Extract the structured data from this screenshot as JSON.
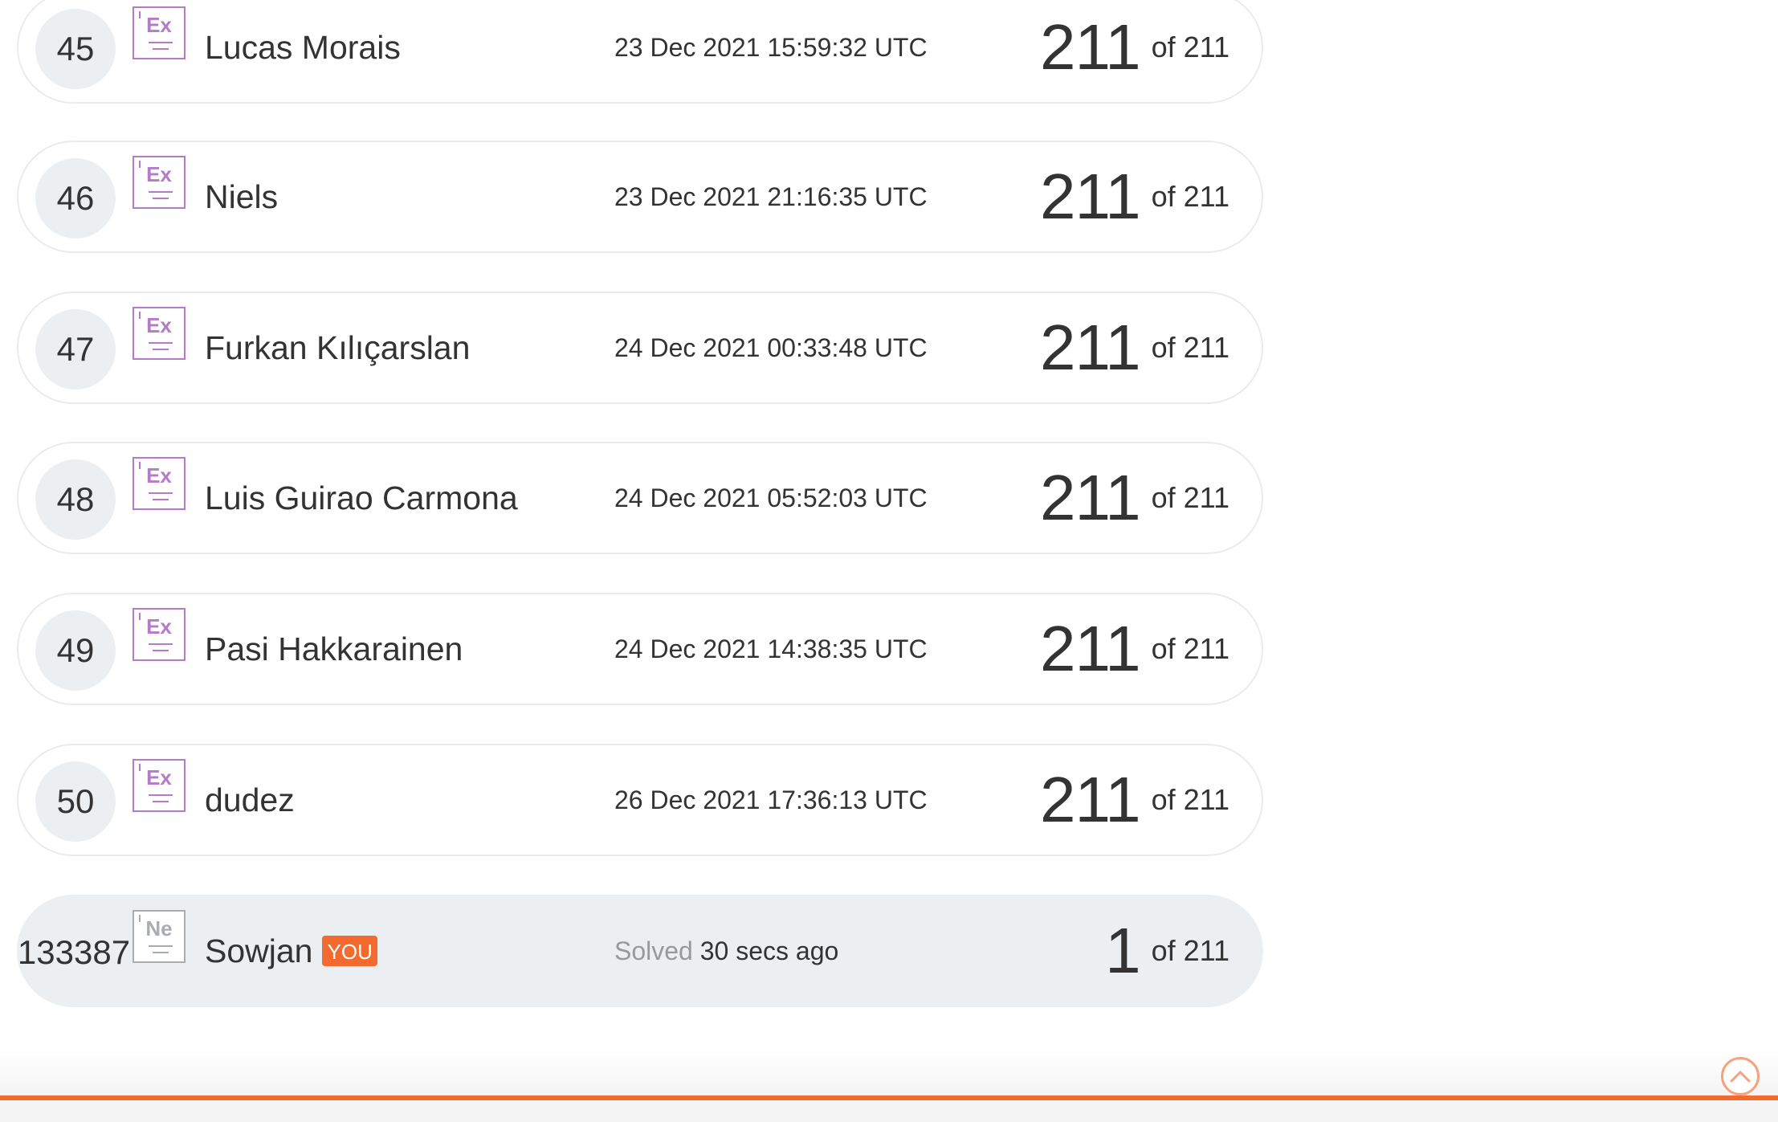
{
  "leaderboard": {
    "rows": [
      {
        "rank": "45",
        "badge": "Ex",
        "name": "Lucas Morais",
        "date": "23 Dec 2021 15:59:32 UTC",
        "score": "211",
        "of": "of 211"
      },
      {
        "rank": "46",
        "badge": "Ex",
        "name": "Niels",
        "date": "23 Dec 2021 21:16:35 UTC",
        "score": "211",
        "of": "of 211"
      },
      {
        "rank": "47",
        "badge": "Ex",
        "name": "Furkan Kılıçarslan",
        "date": "24 Dec 2021 00:33:48 UTC",
        "score": "211",
        "of": "of 211"
      },
      {
        "rank": "48",
        "badge": "Ex",
        "name": "Luis Guirao Carmona",
        "date": "24 Dec 2021 05:52:03 UTC",
        "score": "211",
        "of": "of 211"
      },
      {
        "rank": "49",
        "badge": "Ex",
        "name": "Pasi Hakkarainen",
        "date": "24 Dec 2021 14:38:35 UTC",
        "score": "211",
        "of": "of 211"
      },
      {
        "rank": "50",
        "badge": "Ex",
        "name": "dudez",
        "date": "26 Dec 2021 17:36:13 UTC",
        "score": "211",
        "of": "of 211"
      }
    ],
    "current_user": {
      "rank": "133387",
      "badge": "Ne",
      "name": "Sowjan",
      "you_tag": "YOU",
      "solved_label": "Solved",
      "solved_time": "30 secs ago",
      "score": "1",
      "of": "of 211"
    }
  },
  "colors": {
    "accent": "#f26a2d",
    "expert_badge": "#b57ac8",
    "novice_badge": "#a9adb0",
    "row_border": "#e9ecee",
    "current_row_bg": "#eceff1"
  },
  "icons": {
    "scroll_top": "chevron-up-icon"
  }
}
